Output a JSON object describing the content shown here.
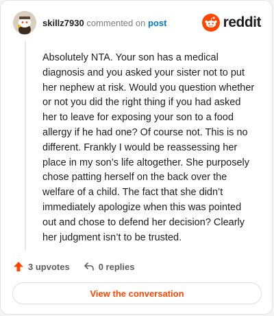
{
  "comment": {
    "username": "skillz7930",
    "commented_on": "commented on",
    "post_link": "post",
    "body": "Absolutely NTA. Your son has a medical diagnosis and you asked your sister not to put her nephew at risk. Would you question whether or not you did the right thing if you had asked her to leave for exposing your son to a food allergy if he had one? Of course not. This is no different. Frankly I would be reassessing her place in my son’s life altogether. She purposely chose patting herself on the back over the welfare of a child. The fact that she didn’t immediately apologize when this was pointed out and chose to defend her decision? Clearly her judgment isn’t to be trusted."
  },
  "brand": {
    "name": "reddit",
    "icon": "reddit-snoo-icon",
    "color": "#ff4500"
  },
  "actions": {
    "upvotes": "3 upvotes",
    "replies": "0 replies"
  },
  "footer": {
    "view_conversation": "View the conversation"
  },
  "colors": {
    "accent": "#ff4500",
    "link": "#0079d3",
    "text": "#1c1c1c",
    "muted": "#7c7c7c"
  }
}
